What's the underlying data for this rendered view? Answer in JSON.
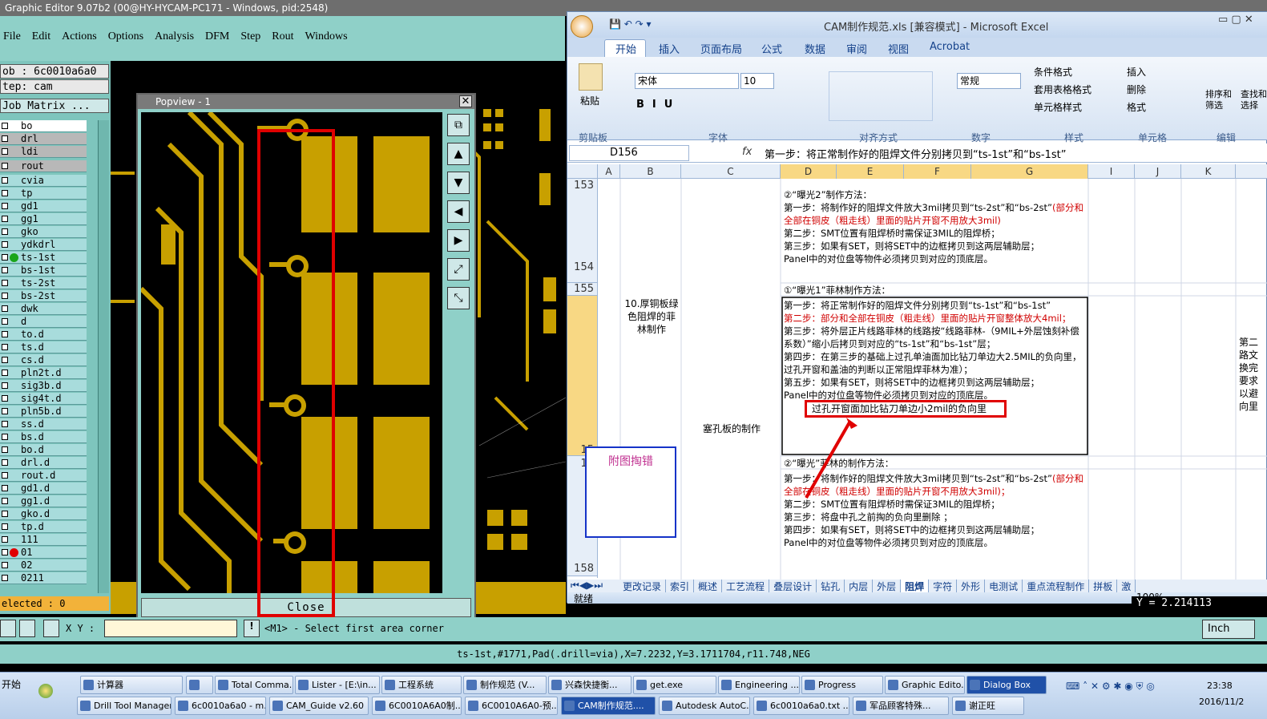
{
  "ge": {
    "title": "Graphic Editor 9.07b2 (00@HY-HYCAM-PC171 - Windows, pid:2548)",
    "menu": [
      "File",
      "Edit",
      "Actions",
      "Options",
      "Analysis",
      "DFM",
      "Step",
      "Rout",
      "Windows"
    ],
    "job": "ob : 6c0010a6a0",
    "step": "tep: cam",
    "job_matrix": "Job Matrix ...",
    "layers": [
      "bo",
      "drl",
      "ldi",
      "rout",
      "cvia",
      "tp",
      "gd1",
      "gg1",
      "gko",
      "ydkdrl",
      "ts-1st",
      "bs-1st",
      "ts-2st",
      "bs-2st",
      "dwk",
      "d",
      "to.d",
      "ts.d",
      "cs.d",
      "pln2t.d",
      "sig3b.d",
      "sig4t.d",
      "pln5b.d",
      "ss.d",
      "bs.d",
      "bo.d",
      "drl.d",
      "rout.d",
      "gd1.d",
      "gg1.d",
      "gko.d",
      "tp.d",
      "111",
      "01",
      "02",
      "0211"
    ],
    "selected": "elected : 0",
    "xy_label": "X Y :",
    "prompt": "<M1> - Select first area corner",
    "status": "ts-1st,#1771,Pad(.drill=via),X=7.2232,Y=3.1711704,r11.748,NEG",
    "unit": "Inch",
    "y_readout": "Y = 2.214113"
  },
  "popview": {
    "title": "Popview - 1",
    "close": "Close"
  },
  "excel": {
    "title": "CAM制作规范.xls  [兼容模式] - Microsoft Excel",
    "tabs": [
      "开始",
      "插入",
      "页面布局",
      "公式",
      "数据",
      "审阅",
      "视图",
      "Acrobat"
    ],
    "font_name": "宋体",
    "font_size": "10",
    "number_format": "常规",
    "groups": [
      "剪贴板",
      "字体",
      "对齐方式",
      "数字",
      "样式",
      "单元格",
      "编辑"
    ],
    "paste": "粘贴",
    "style_buttons": [
      "条件格式",
      "套用表格格式",
      "单元格样式"
    ],
    "cell_buttons": [
      "插入",
      "删除",
      "格式"
    ],
    "edit_buttons": [
      "排序和筛选",
      "查找和选择"
    ],
    "name_box": "D156",
    "fx": "fx",
    "formula": "第一步：将正常制作好的阻焊文件分别拷贝到“ts-1st”和“bs-1st”",
    "columns": [
      "A",
      "B",
      "C",
      "D",
      "E",
      "F",
      "G",
      "I",
      "J",
      "K"
    ],
    "rows": [
      "153",
      "154",
      "155",
      "15",
      "15",
      "158"
    ],
    "b_cell": "10.厚铜板绿色阻焊的菲林制作",
    "c_cell": "塞孔板的制作",
    "block1_title": "②“曝光2”制作方法：",
    "block1_lines": [
      {
        "t": "第一步：将制作好的阻焊文件放大3mil拷贝到“ts-2st”和“bs-2st”",
        "r": "(部分和全部在铜皮（粗走线）里面的贴片开窗不用放大3mil)"
      },
      {
        "t": "第二步：SMT位置有阻焊桥时需保证3MIL的阻焊桥；",
        "r": ""
      },
      {
        "t": "第三步：如果有SET，则将SET中的边框拷贝到这两层辅助层；",
        "r": ""
      },
      {
        "t": "Panel中的对位盘等物件必须拷贝到对应的顶底层。",
        "r": ""
      }
    ],
    "block2_title": "①“曝光1”菲林制作方法：",
    "block2_lines": [
      {
        "t": "第一步：将正常制作好的阻焊文件分别拷贝到“ts-1st”和“bs-1st”",
        "r": ""
      },
      {
        "t": "",
        "r": "第二步：部分和全部在铜皮（粗走线）里面的贴片开窗整体放大4mil；"
      },
      {
        "t": "第三步：将外层正片线路菲林的线路按“线路菲林-（9MIL+外层蚀刻补偿系数）”缩小后拷贝到对应的“ts-1st”和“bs-1st”层；",
        "r": ""
      },
      {
        "t": "第四步：在第三步的基础上过孔单油面加比钻刀单边大2.5MIL的负向里，过孔开窗和盖油的判断以正常阻焊菲林为准）；",
        "r": ""
      },
      {
        "t": "第五步：如果有SET，则将SET中的边框拷贝到这两层辅助层；",
        "r": ""
      },
      {
        "t": "Panel中的对位盘等物件必须拷贝到对应的顶底层。",
        "r": ""
      }
    ],
    "callout": "过孔开窗面加比钻刀单边小2mil的负向里",
    "block3_title": "②“曝光”菲林的制作方法：",
    "block3_lines": [
      {
        "t": "第一步：将制作好的阻焊文件放大3mil拷贝到“ts-2st”和“bs-2st”",
        "r": "(部分和全部在铜皮（粗走线）里面的贴片开窗不用放大3mil)；"
      },
      {
        "t": "第二步：SMT位置有阻焊桥时需保证3MIL的阻焊桥；",
        "r": ""
      },
      {
        "t": "第三步：将盘中孔之前掏的负向里删除 ；",
        "r": ""
      },
      {
        "t": "第四步：如果有SET，则将SET中的边框拷贝到这两层辅助层；",
        "r": ""
      },
      {
        "t": "Panel中的对位盘等物件必须拷贝到对应的顶底层。",
        "r": ""
      }
    ],
    "note_box": "附图掏错",
    "right_text": [
      "第二",
      "路文",
      "换完",
      "要求",
      "以避",
      "向里"
    ],
    "sheet_tabs": [
      "更改记录",
      "索引",
      "概述",
      "工艺流程",
      "叠层设计",
      "钻孔",
      "内层",
      "外层",
      "阻焊",
      "字符",
      "外形",
      "电测试",
      "重点流程制作",
      "拼板",
      "激"
    ],
    "status_ready": "就绪",
    "zoom": "100%"
  },
  "taskbar": {
    "start": "开始",
    "row1": [
      "计算器",
      "",
      "Total Comma...",
      "Lister - [E:\\in...",
      "工程系统",
      "制作规范 (V...",
      "兴森快捷衡...",
      "get.exe",
      "Engineering ...",
      "Progress",
      "Graphic Edito...",
      "Dialog Box"
    ],
    "row2": [
      "Drill Tool Manager",
      "6c0010a6a0 - m...",
      "CAM_Guide v2.60",
      "6C0010A6A0制...",
      "6C0010A6A0-预...",
      "CAM制作规范....",
      "Autodesk AutoC...",
      "6c0010a6a0.txt ...",
      "军品顾客特殊...",
      "谢正旺"
    ],
    "time": "23:38",
    "date": "2016/11/2"
  }
}
